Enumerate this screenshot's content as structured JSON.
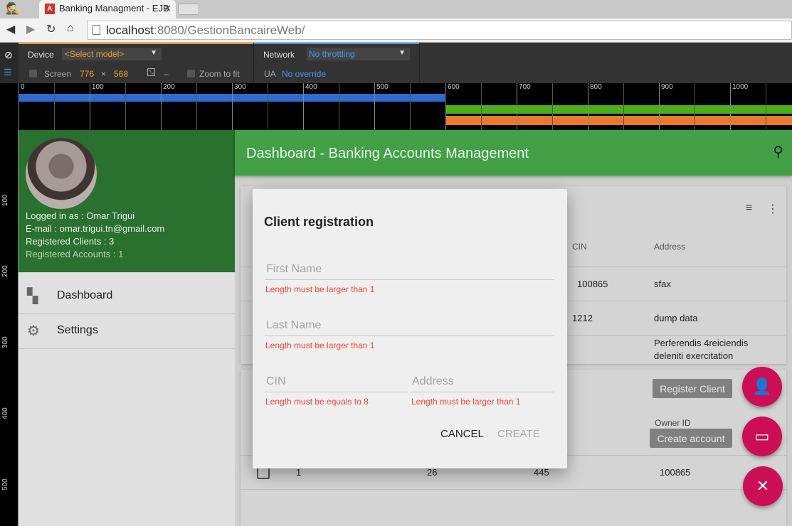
{
  "browser": {
    "tab_title": "Banking Managment - EJB",
    "url_host": "localhost",
    "url_rest": ":8080/GestionBancaireWeb/"
  },
  "devtools": {
    "device_label": "Device",
    "device_value": "<Select model>",
    "screen_label": "Screen",
    "screen_w": "776",
    "screen_x": "×",
    "screen_h": "568",
    "scale_value": "–",
    "zoom_label": "Zoom to fit",
    "network_label": "Network",
    "network_value": "No throttling",
    "ua_label": "UA",
    "ua_value": "No override",
    "h_ruler": [
      "0",
      "100",
      "200",
      "300",
      "400",
      "500",
      "600",
      "700",
      "800",
      "900",
      "1000"
    ],
    "v_ruler": [
      "100",
      "200",
      "300",
      "400",
      "500"
    ]
  },
  "sidebar": {
    "logged": "Logged in as : Omar Trigui",
    "email": "E-mail : omar.trigui.tn@gmail.com",
    "clients": "Registered Clients : 3",
    "accounts": "Registered Accounts : 1",
    "items": [
      {
        "label": "Dashboard",
        "icon": "dashboard-icon"
      },
      {
        "label": "Settings",
        "icon": "gear-icon"
      }
    ]
  },
  "header": {
    "title": "Dashboard - Banking Accounts Management"
  },
  "clients_table": {
    "headers": {
      "cin": "CIN",
      "address": "Address"
    },
    "rows": [
      {
        "cin": "100865",
        "address": "sfax"
      },
      {
        "cin": "1212",
        "address": "dump data"
      },
      {
        "cin": "",
        "address": "Perferendis 4reiciendis deleniti exercitation"
      }
    ]
  },
  "accounts_table": {
    "header_owner": "Owner ID",
    "rows": [
      {
        "c1": "1",
        "c2": "26",
        "c3": "445",
        "owner": "100865"
      }
    ]
  },
  "buttons": {
    "register_client": "Register Client",
    "create_account": "Create account"
  },
  "dialog": {
    "title": "Client registration",
    "first_name": "First Name",
    "first_name_error": "Length must be larger than 1",
    "last_name": "Last Name",
    "last_name_error": "Length must be larger than 1",
    "cin": "CIN",
    "cin_error": "Length must be equals to 8",
    "address": "Address",
    "address_error": "Length must be larger than 1",
    "cancel": "CANCEL",
    "create": "CREATE"
  },
  "colors": {
    "sidebar_header": "#2a702f",
    "app_header": "#43a047",
    "fab": "#cc0e55",
    "error": "#f44336"
  }
}
